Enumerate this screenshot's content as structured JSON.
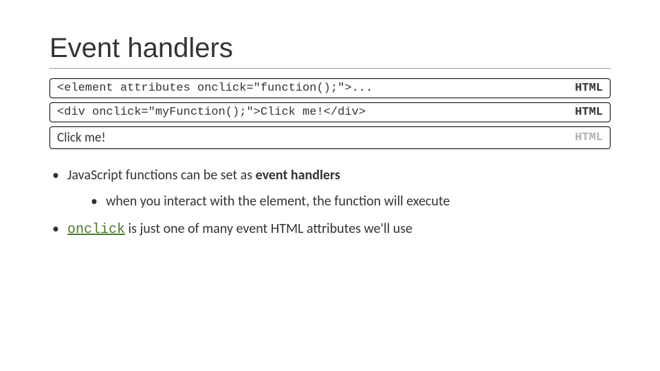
{
  "title": "Event handlers",
  "codebox1": {
    "code": "<element attributes onclick=\"function();\">...",
    "tag": "HTML"
  },
  "codebox2": {
    "code": "<div onclick=\"myFunction();\">Click me!</div>",
    "tag": "HTML"
  },
  "demobox": {
    "text": "Click me!",
    "tag": "HTML"
  },
  "bullets": {
    "b1_pre": "JavaScript functions can be set as ",
    "b1_bold": "event handlers",
    "b1_sub": "when you interact with the element, the function will execute",
    "b2_code": "onclick",
    "b2_rest": " is just one of many event HTML attributes we'll use"
  }
}
